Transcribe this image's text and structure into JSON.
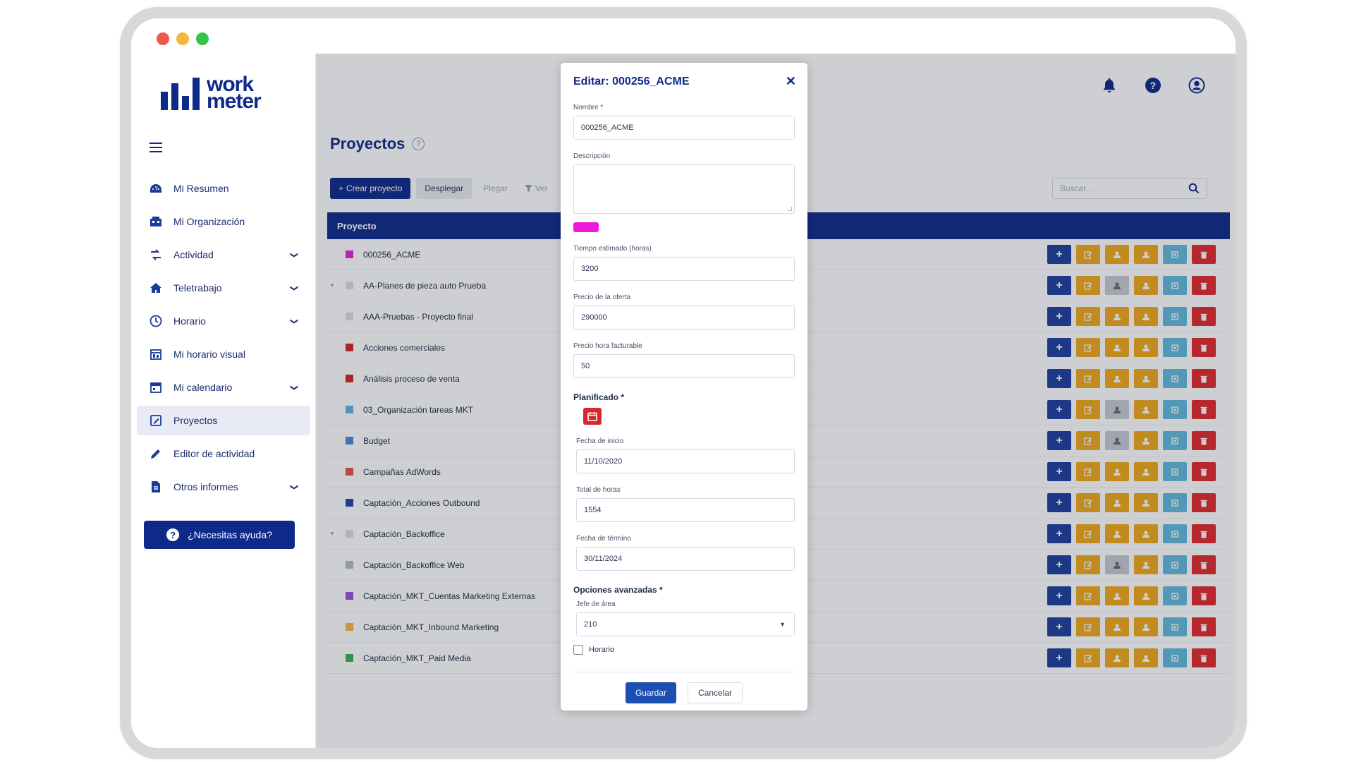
{
  "app": {
    "logo_line1": "work",
    "logo_line2": "meter"
  },
  "sidebar": {
    "items": [
      {
        "label": "Mi Resumen",
        "icon": "dashboard-icon",
        "expandable": false,
        "active": false
      },
      {
        "label": "Mi Organización",
        "icon": "organization-icon",
        "expandable": false,
        "active": false
      },
      {
        "label": "Actividad",
        "icon": "activity-icon",
        "expandable": true,
        "active": false
      },
      {
        "label": "Teletrabajo",
        "icon": "home-icon",
        "expandable": true,
        "active": false
      },
      {
        "label": "Horario",
        "icon": "clock-icon",
        "expandable": true,
        "active": false
      },
      {
        "label": "Mi horario visual",
        "icon": "visual-schedule-icon",
        "expandable": false,
        "active": false
      },
      {
        "label": "Mi calendario",
        "icon": "calendar-icon",
        "expandable": true,
        "active": false
      },
      {
        "label": "Proyectos",
        "icon": "projects-icon",
        "expandable": false,
        "active": true
      },
      {
        "label": "Editor de actividad",
        "icon": "pencil-icon",
        "expandable": false,
        "active": false
      },
      {
        "label": "Otros informes",
        "icon": "report-icon",
        "expandable": true,
        "active": false
      }
    ],
    "help_label": "¿Necesitas ayuda?"
  },
  "main": {
    "title": "Proyectos",
    "toolbar": {
      "create": "Crear proyecto",
      "expand": "Desplegar",
      "collapse": "Plegar",
      "view": "Ver"
    },
    "search_placeholder": "Buscar...",
    "table_header": "Proyecto",
    "rows": [
      {
        "name": "000256_ACME",
        "color": "#e81fd9",
        "caret": "",
        "third_gray": false
      },
      {
        "name": "AA-Planes de pieza auto Prueba",
        "color": "#d9dbe1",
        "caret": "▾",
        "third_gray": true
      },
      {
        "name": "AAA-Pruebas - Proyecto final",
        "color": "#d9dbe1",
        "caret": "",
        "third_gray": false
      },
      {
        "name": "Acciones comerciales",
        "color": "#d42525",
        "caret": "",
        "third_gray": false
      },
      {
        "name": "Análisis proceso de venta",
        "color": "#d42525",
        "caret": "",
        "third_gray": false
      },
      {
        "name": "03_Organización tareas MKT",
        "color": "#5fb3e0",
        "caret": "",
        "third_gray": true
      },
      {
        "name": "Budget",
        "color": "#4a8bd6",
        "caret": "",
        "third_gray": true
      },
      {
        "name": "Campañas AdWords",
        "color": "#e55050",
        "caret": "",
        "third_gray": false
      },
      {
        "name": "Captación_Acciones Outbound",
        "color": "#2040b0",
        "caret": "",
        "third_gray": false
      },
      {
        "name": "Captación_Backoffice",
        "color": "#d9dbe1",
        "caret": "▾",
        "third_gray": false
      },
      {
        "name": "Captación_Backoffice Web",
        "color": "#b7bac4",
        "caret": "",
        "third_gray": true
      },
      {
        "name": "Captación_MKT_Cuentas Marketing Externas",
        "color": "#9b4fd4",
        "caret": "",
        "third_gray": false
      },
      {
        "name": "Captación_MKT_Inbound Marketing",
        "color": "#f5b440",
        "caret": "",
        "third_gray": false
      },
      {
        "name": "Captación_MKT_Paid Media",
        "color": "#34b548",
        "caret": "",
        "third_gray": false
      }
    ]
  },
  "modal": {
    "title": "Editar: 000256_ACME",
    "nombre_label": "Nombre *",
    "nombre_value": "000256_ACME",
    "descripcion_label": "Descripción",
    "descripcion_value": "",
    "color_value": "#ee19dc",
    "tiempo_label": "Tiempo estimado (horas)",
    "tiempo_value": "3200",
    "precio_oferta_label": "Precio de la oferta",
    "precio_oferta_value": "290000",
    "precio_hora_label": "Precio hora facturable",
    "precio_hora_value": "50",
    "planificado_label": "Planificado *",
    "fecha_inicio_label": "Fecha de inicio",
    "fecha_inicio_value": "11/10/2020",
    "total_horas_label": "Total de horas",
    "total_horas_value": "1554",
    "fecha_termino_label": "Fecha de término",
    "fecha_termino_value": "30/11/2024",
    "opciones_label": "Opciones avanzadas *",
    "jefe_label": "Jefe de área",
    "jefe_value": "210",
    "horario_label": "Horario",
    "horario_checked": false,
    "save": "Guardar",
    "cancel": "Cancelar"
  }
}
